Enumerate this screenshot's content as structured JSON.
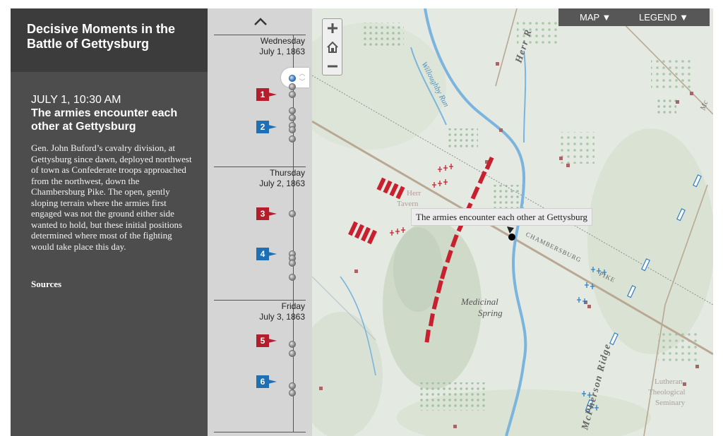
{
  "app": {
    "title": "Decisive Moments in the Battle of Gettysburg"
  },
  "event": {
    "time": "JULY 1, 10:30 AM",
    "title": "The armies encounter each other at Gettysburg",
    "description": "Gen. John Buford’s cavalry division, at Gettysburg since dawn, deployed northwest of town as Confederate troops approached from the northwest, down the Chambersburg Pike. The open, gently sloping terrain where the armies first engaged was not the ground either side wanted to hold, but these initial positions determined where most of the fighting would take place this day.",
    "sources_label": "Sources"
  },
  "timeline": {
    "days": [
      {
        "weekday": "Wednesday",
        "date": "July 1, 1863"
      },
      {
        "weekday": "Thursday",
        "date": "July 2, 1863"
      },
      {
        "weekday": "Friday",
        "date": "July 3, 1863"
      }
    ],
    "markers": [
      {
        "number": "1",
        "side": "red"
      },
      {
        "number": "2",
        "side": "blue"
      },
      {
        "number": "3",
        "side": "red"
      },
      {
        "number": "4",
        "side": "blue"
      },
      {
        "number": "5",
        "side": "red"
      },
      {
        "number": "6",
        "side": "blue"
      }
    ],
    "active_index": 0
  },
  "map": {
    "menu_label": "MAP ▼",
    "legend_label": "LEGEND ▼",
    "tooltip": "The armies encounter each other at Gettysburg",
    "labels": {
      "herr_ridge": "Herr R",
      "willoughby_run": "Willoughby Run",
      "herr_tavern_1": "Herr",
      "herr_tavern_2": "Tavern",
      "chambersburg": "CHAMBERSBURG",
      "pike": "PIKE",
      "medicinal_1": "Medicinal",
      "medicinal_2": "Spring",
      "mcpherson_ridge": "McPherson Ridge",
      "seminary_1": "Lutheran",
      "seminary_2": "Theological",
      "seminary_3": "Seminary",
      "mc_edge": "Mc"
    },
    "colors": {
      "confederate": "#c8202e",
      "union": "#2f7fc4",
      "water": "#7bb4dd",
      "road": "#b9a893"
    }
  }
}
